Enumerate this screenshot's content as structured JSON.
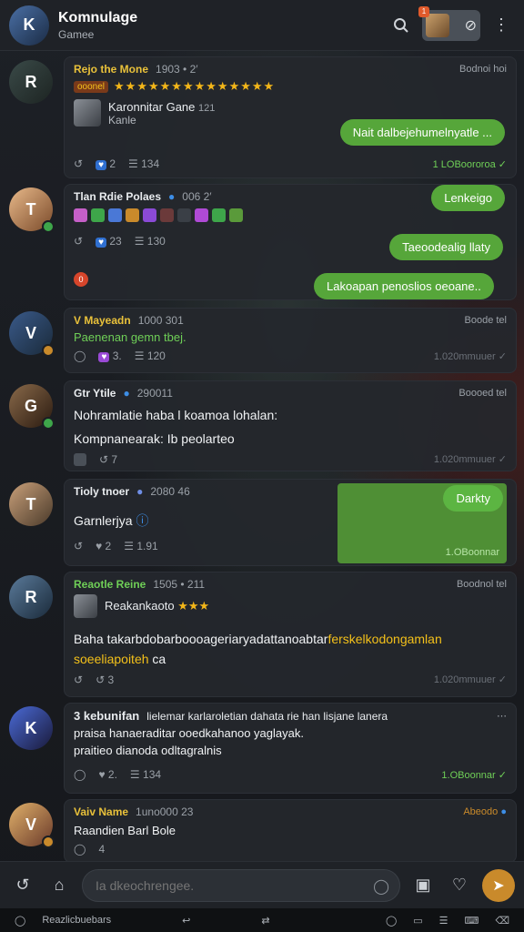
{
  "header": {
    "title": "Komnulage",
    "subtitle": "Gamee",
    "search_icon": "search-icon",
    "menu_icon": "more-vertical-icon",
    "notif_count": "1"
  },
  "messages": [
    {
      "name": "Rejo the Mone",
      "meta": "1903  •  2′",
      "time": "Bodnoi hoi",
      "tag": "ooonel",
      "stars": "★★★★★★★★★★★★★★",
      "quote_title": "Karonnitar Gane",
      "quote_meta": "121",
      "quote_sub": "Kanle",
      "likes": "2",
      "views": "134",
      "read": "1 LOBoororoa",
      "reply": "Nait dalbejehumelnyatle ..."
    },
    {
      "name": "Tlan Rdie Polaes",
      "meta": "006  2′",
      "likes": "23",
      "views": "130",
      "reply1": "Lenkeigo",
      "reply2": "Taeoodealig llaty",
      "reply3": "Lakoapan penoslios oeoane..",
      "badge": "0"
    },
    {
      "name": "V Mayeadn",
      "meta": "1000  301",
      "time": "Boode tel",
      "text": "Paenenan gemn tbej.",
      "likes": "3.",
      "views": "120",
      "read": "1.020mmuuer"
    },
    {
      "name": "Gtr Ytile",
      "meta": "290011",
      "time": "Boooed tel",
      "text1": "Nohramlatie haba l koamoa lohalan:",
      "text2": "Kompnanearak: Ib peolarteo",
      "views": "7",
      "read": "1.020mmuuer"
    },
    {
      "name": "Tioly tnoer",
      "meta": "2080 46",
      "text": "Garnlerjya",
      "likes": "2",
      "views": "1.91",
      "reply": "Darkty",
      "read": "1.OBoonnar"
    },
    {
      "name": "Reaotle Reine",
      "meta": "1505  •  211",
      "time": "Boodnol tel",
      "subname": "Reakankaoto",
      "text_white": "Baha takarbdobarboooageriaryadattanoabtar",
      "text_yellow": "ferskelkodongamlan",
      "text_yellow2": "soeeliapoiteh",
      "text_tail": "ca",
      "views": "3",
      "read": "1.020mmuuer"
    },
    {
      "name": "3  kebunifan",
      "text1": "lielemar karlaroletian dahata rie han lisjane lanera",
      "text2": "praisa hanaeraditar ooedkahanoo yaglayak.",
      "text3": "praitieo dianoda odltagralnis",
      "likes": "2.",
      "views": "134",
      "read": "1.OBoonnar"
    },
    {
      "name": "Vaiv  Name",
      "meta": "1uno000  23",
      "time": "Abeodo",
      "text": "Raandien Barl  Bole",
      "views": "4"
    }
  ],
  "composer": {
    "placeholder": "Ia dkeochrengee."
  },
  "system_bar": {
    "left_label": "Reazlicbuebars"
  },
  "colors": {
    "accent_green": "#56a63a",
    "send_button": "#c98a2b",
    "name_yellow": "#e9c13a"
  }
}
